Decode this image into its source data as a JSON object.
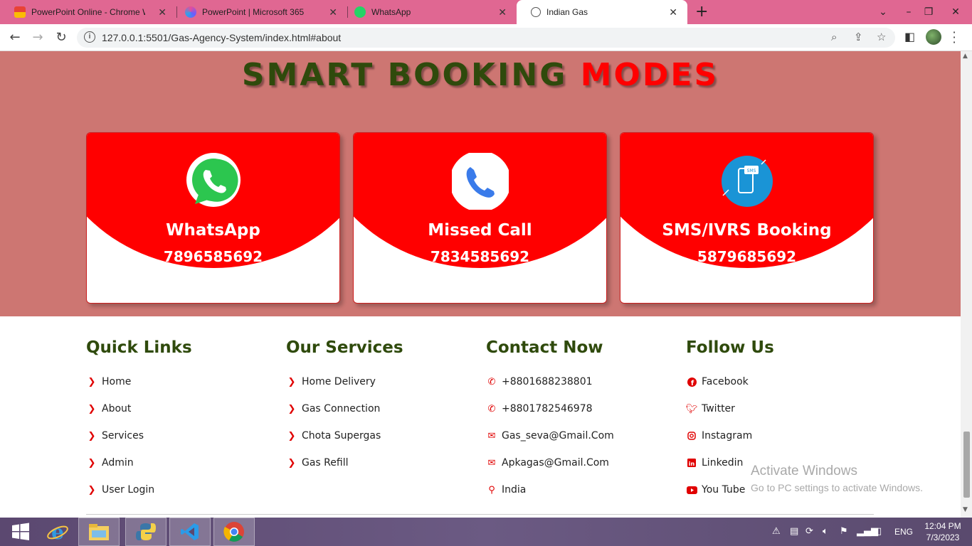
{
  "browser": {
    "tabs": [
      {
        "label": "PowerPoint Online - Chrome Web",
        "active": false
      },
      {
        "label": "PowerPoint | Microsoft 365",
        "active": false
      },
      {
        "label": "WhatsApp",
        "active": false
      },
      {
        "label": "Indian Gas",
        "active": true
      }
    ],
    "url": "127.0.0.1:5501/Gas-Agency-System/index.html#about"
  },
  "booking": {
    "title_main": "SMART BOOKING",
    "title_accent": "MODES",
    "cards": [
      {
        "name": "WhatsApp",
        "number": "7896585692",
        "icon": "whatsapp-icon"
      },
      {
        "name": "Missed Call",
        "number": "7834585692",
        "icon": "phone-icon"
      },
      {
        "name": "SMS/IVRS Booking",
        "number": "5879685692",
        "icon": "sms-icon"
      }
    ]
  },
  "footer": {
    "quick_links": {
      "title": "Quick Links",
      "items": [
        "Home",
        "About",
        "Services",
        "Admin",
        "User Login"
      ]
    },
    "services": {
      "title": "Our Services",
      "items": [
        "Home Delivery",
        "Gas Connection",
        "Chota Supergas",
        "Gas Refill"
      ]
    },
    "contact": {
      "title": "Contact Now",
      "items": [
        {
          "icon": "phone-icon",
          "text": "+8801688238801"
        },
        {
          "icon": "phone-icon",
          "text": "+8801782546978"
        },
        {
          "icon": "envelope-icon",
          "text": "Gas_seva@Gmail.Com"
        },
        {
          "icon": "envelope-icon",
          "text": "Apkagas@Gmail.Com"
        },
        {
          "icon": "map-marker-icon",
          "text": "India"
        }
      ]
    },
    "follow": {
      "title": "Follow Us",
      "items": [
        {
          "icon": "facebook-icon",
          "text": "Facebook"
        },
        {
          "icon": "twitter-icon",
          "text": "Twitter"
        },
        {
          "icon": "instagram-icon",
          "text": "Instagram"
        },
        {
          "icon": "linkedin-icon",
          "text": "Linkedin"
        },
        {
          "icon": "youtube-icon",
          "text": "You Tube"
        }
      ]
    }
  },
  "watermark": {
    "line1": "Activate Windows",
    "line2": "Go to PC settings to activate Windows."
  },
  "taskbar": {
    "lang": "ENG",
    "time": "12:04 PM",
    "date": "7/3/2023"
  },
  "colors": {
    "accent_red": "#ff0000",
    "heading_green": "#2f4a0c",
    "section_bg": "#cd7672",
    "tabbar": "#e06792"
  }
}
